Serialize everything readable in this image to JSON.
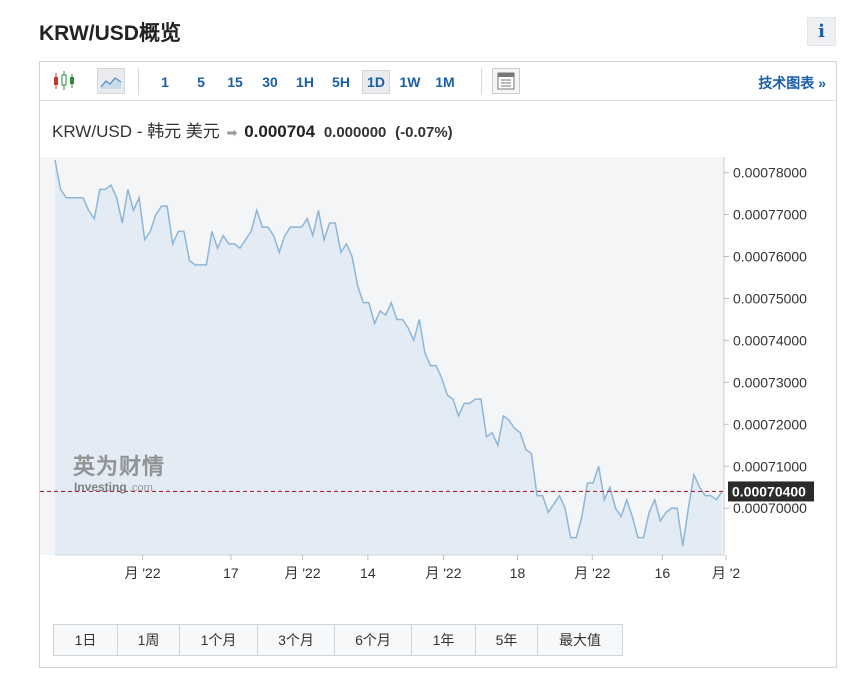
{
  "page": {
    "title": "KRW/USD概览",
    "info_label": "i"
  },
  "toolbar": {
    "timeframes": [
      "1",
      "5",
      "15",
      "30",
      "1H",
      "5H",
      "1D",
      "1W",
      "1M"
    ],
    "active_timeframe": "1D",
    "tech_chart_label": "技术图表 »",
    "icons": [
      "candlestick-icon",
      "area-chart-icon",
      "table-view-icon"
    ]
  },
  "quote": {
    "pair": "KRW/USD - 韩元 美元",
    "price": "0.000704",
    "change": "0.000000",
    "change_pct": "(-0.07%)"
  },
  "ranges": [
    "1日",
    "1周",
    "1个月",
    "3个月",
    "6个月",
    "1年",
    "5年",
    "最大值"
  ],
  "watermark": {
    "cn": "英为财情",
    "en": "Investing",
    "suffix": ".com"
  },
  "colors": {
    "line": "#8db6d8",
    "fill": "#e3ecf4",
    "current_line": "#b0283a",
    "price_tag_bg": "#2b2b2b",
    "link": "#1a5fa8"
  },
  "chart_data": {
    "type": "area",
    "title": "",
    "xlabel": "",
    "ylabel": "",
    "ylim": [
      0.00068885,
      0.00078372
    ],
    "yticks": [
      "0.00078000",
      "0.00077000",
      "0.00076000",
      "0.00075000",
      "0.00074000",
      "0.00073000",
      "0.00072000",
      "0.00071000",
      "0.00070000"
    ],
    "ytick_values": [
      0.00078,
      0.00077,
      0.00076,
      0.00075,
      0.00074,
      0.00073,
      0.00072,
      0.00071,
      0.0007
    ],
    "xticks": [
      "月 '22",
      "17",
      "月 '22",
      "14",
      "月 '22",
      "18",
      "月 '22",
      "16",
      "月 '2"
    ],
    "xtick_positions": [
      11.0,
      22.1,
      31.1,
      39.3,
      48.8,
      58.1,
      67.5,
      76.3,
      84.3
    ],
    "current_price": 0.000704,
    "current_label": "0.00070400",
    "grid": false,
    "series": [
      {
        "values": [
          0.000783,
          0.000776,
          0.000774,
          0.000774,
          0.000774,
          0.000774,
          0.000771,
          0.000769,
          0.000776,
          0.000776,
          0.000777,
          0.000774,
          0.000768,
          0.000776,
          0.000771,
          0.000774,
          0.000764,
          0.000766,
          0.00077,
          0.000772,
          0.000772,
          0.000763,
          0.000766,
          0.000766,
          0.000759,
          0.000758,
          0.000758,
          0.000758,
          0.000766,
          0.000762,
          0.000765,
          0.000763,
          0.000763,
          0.000762,
          0.000764,
          0.000766,
          0.000771,
          0.000767,
          0.000767,
          0.000765,
          0.000761,
          0.000765,
          0.000767,
          0.000767,
          0.000767,
          0.000769,
          0.000765,
          0.000771,
          0.000764,
          0.000768,
          0.000768,
          0.000761,
          0.000763,
          0.00076,
          0.000753,
          0.000749,
          0.000749,
          0.000744,
          0.000747,
          0.000746,
          0.000749,
          0.000745,
          0.000745,
          0.000743,
          0.00074,
          0.000745,
          0.000737,
          0.000734,
          0.000734,
          0.000731,
          0.000727,
          0.000726,
          0.000722,
          0.000725,
          0.000725,
          0.000726,
          0.000726,
          0.000717,
          0.000718,
          0.000715,
          0.000722,
          0.000721,
          0.000719,
          0.000718,
          0.000714,
          0.000713,
          0.000703,
          0.000703,
          0.000699,
          0.000701,
          0.000703,
          0.0007,
          0.000693,
          0.000693,
          0.000698,
          0.000706,
          0.000706,
          0.00071,
          0.000702,
          0.000705,
          0.0007,
          0.000698,
          0.000702,
          0.000698,
          0.000693,
          0.000693,
          0.000699,
          0.000702,
          0.000697,
          0.000699,
          0.0007,
          0.0007,
          0.000691,
          0.0007,
          0.000708,
          0.000705,
          0.000703,
          0.000703,
          0.000702,
          0.000704
        ]
      }
    ]
  }
}
